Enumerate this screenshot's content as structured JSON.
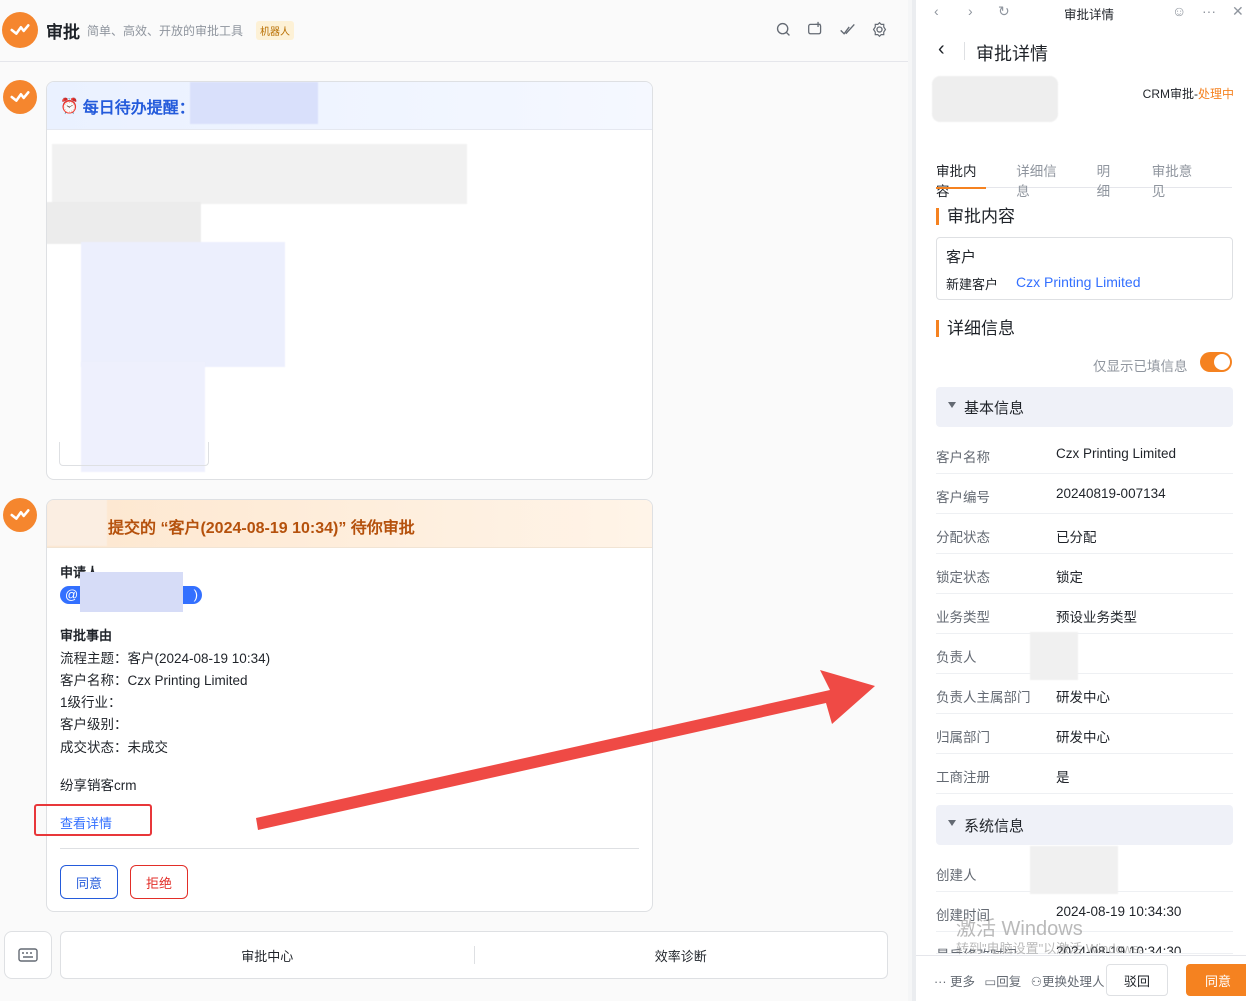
{
  "header": {
    "app_title": "审批",
    "app_desc": "简单、高效、开放的审批工具",
    "badge": "机器人"
  },
  "card1": {
    "title": "每日待办提醒："
  },
  "card2": {
    "title": "提交的 “客户(2024-08-19 10:34)” 待你审批",
    "applicant_label": "申请人",
    "mention": "@",
    "mention_close": ")",
    "reason_label": "审批事由",
    "lines": [
      "流程主题：客户(2024-08-19 10:34)",
      "客户名称：Czx Printing Limited",
      "1级行业：",
      "客户级别：",
      "成交状态：未成交"
    ],
    "source": "纷享销客crm",
    "detail_link": "查看详情",
    "agree": "同意",
    "reject": "拒绝"
  },
  "bottom": {
    "menu": [
      "审批中心",
      "效率诊断"
    ]
  },
  "panel": {
    "nav_title": "审批详情",
    "title": "审批详情",
    "status_prefix": "CRM审批-",
    "status": "处理中",
    "tabs": [
      "审批内容",
      "详细信息",
      "明细",
      "审批意见"
    ],
    "section_content": "审批内容",
    "content_key": "客户",
    "content_sub": "新建客户",
    "content_link": "Czx Printing Limited",
    "section_detail": "详细信息",
    "toggle_label": "仅显示已填信息",
    "group_basic": "基本信息",
    "basic_rows": [
      {
        "k": "客户名称",
        "v": "Czx Printing Limited"
      },
      {
        "k": "客户编号",
        "v": "20240819-007134"
      },
      {
        "k": "分配状态",
        "v": "已分配"
      },
      {
        "k": "锁定状态",
        "v": "锁定"
      },
      {
        "k": "业务类型",
        "v": "预设业务类型"
      },
      {
        "k": "负责人",
        "v": ""
      },
      {
        "k": "负责人主属部门",
        "v": "研发中心"
      },
      {
        "k": "归属部门",
        "v": "研发中心"
      },
      {
        "k": "工商注册",
        "v": "是"
      }
    ],
    "group_system": "系统信息",
    "system_rows": [
      {
        "k": "创建人",
        "v": ""
      },
      {
        "k": "创建时间",
        "v": "2024-08-19 10:34:30"
      },
      {
        "k": "最后修改时间",
        "v": "2024-08-19 10:34:30"
      }
    ],
    "footer_more": "··· 更多",
    "footer_reply": "回复",
    "footer_transfer": "更换处理人",
    "footer_back": "驳回",
    "footer_agree": "同意",
    "watermark": "激活 Windows",
    "watermark_sub": "转到\"电脑设置\"以激活 Windows。"
  },
  "colors": {
    "accent": "#f58220",
    "link": "#3370ff",
    "arrow": "#ef4a45"
  }
}
